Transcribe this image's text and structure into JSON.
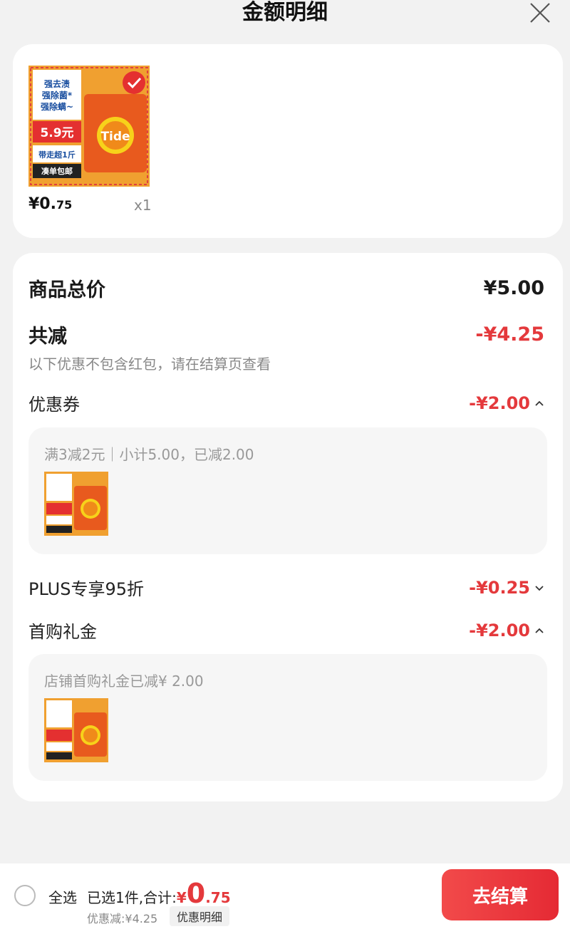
{
  "header": {
    "title": "金额明细"
  },
  "product": {
    "price_main": "¥0.",
    "price_cents": "75",
    "qty": "x1",
    "thumb_texts": {
      "line1": "强去渍",
      "line2": "强除菌*",
      "line3": "强除螨~",
      "promo": "5.9元",
      "pack": "带走超1斤",
      "ship": "凑单包邮",
      "brand": "Tide"
    }
  },
  "summary": {
    "total_label": "商品总价",
    "total_value": "¥5.00",
    "reduce_label": "共减",
    "reduce_value": "-¥4.25",
    "note": "以下优惠不包含红包，请在结算页查看"
  },
  "discounts": {
    "coupon": {
      "label": "优惠券",
      "value": "-¥2.00",
      "detail": "满3减2元｜小计5.00，已减2.00"
    },
    "plus": {
      "label": "PLUS专享95折",
      "value": "-¥0.25"
    },
    "first": {
      "label": "首购礼金",
      "value": "-¥2.00",
      "detail": "店铺首购礼金已减¥ 2.00"
    }
  },
  "footer": {
    "select_all": "全选",
    "summary_prefix": "已选1件,合计:",
    "amount_yen": "¥",
    "amount_main": "0",
    "amount_cents": ".75",
    "discount_line": "优惠减:¥4.25",
    "detail_chip": "优惠明细",
    "checkout": "去结算"
  },
  "colors": {
    "accent": "#e4393c",
    "background": "#f2f2f2"
  }
}
